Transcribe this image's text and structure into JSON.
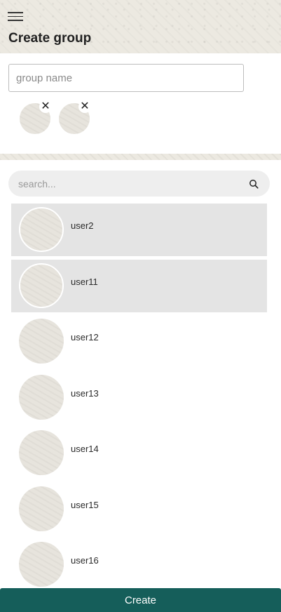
{
  "header": {
    "title": "Create group",
    "menu_icon": "hamburger-menu-icon"
  },
  "group_name": {
    "value": "",
    "placeholder": "group name"
  },
  "selected_members": [
    {
      "remove_label": "✕"
    },
    {
      "remove_label": "✕"
    }
  ],
  "search": {
    "value": "",
    "placeholder": "search...",
    "icon": "search-icon"
  },
  "users": [
    {
      "name": "user2",
      "selected": true
    },
    {
      "name": "user11",
      "selected": true
    },
    {
      "name": "user12",
      "selected": false
    },
    {
      "name": "user13",
      "selected": false
    },
    {
      "name": "user14",
      "selected": false
    },
    {
      "name": "user15",
      "selected": false
    },
    {
      "name": "user16",
      "selected": false
    }
  ],
  "footer": {
    "create_label": "Create"
  },
  "colors": {
    "accent": "#155e5a",
    "selected_row": "#e4e4e4",
    "header_bg": "#ece9e1"
  }
}
